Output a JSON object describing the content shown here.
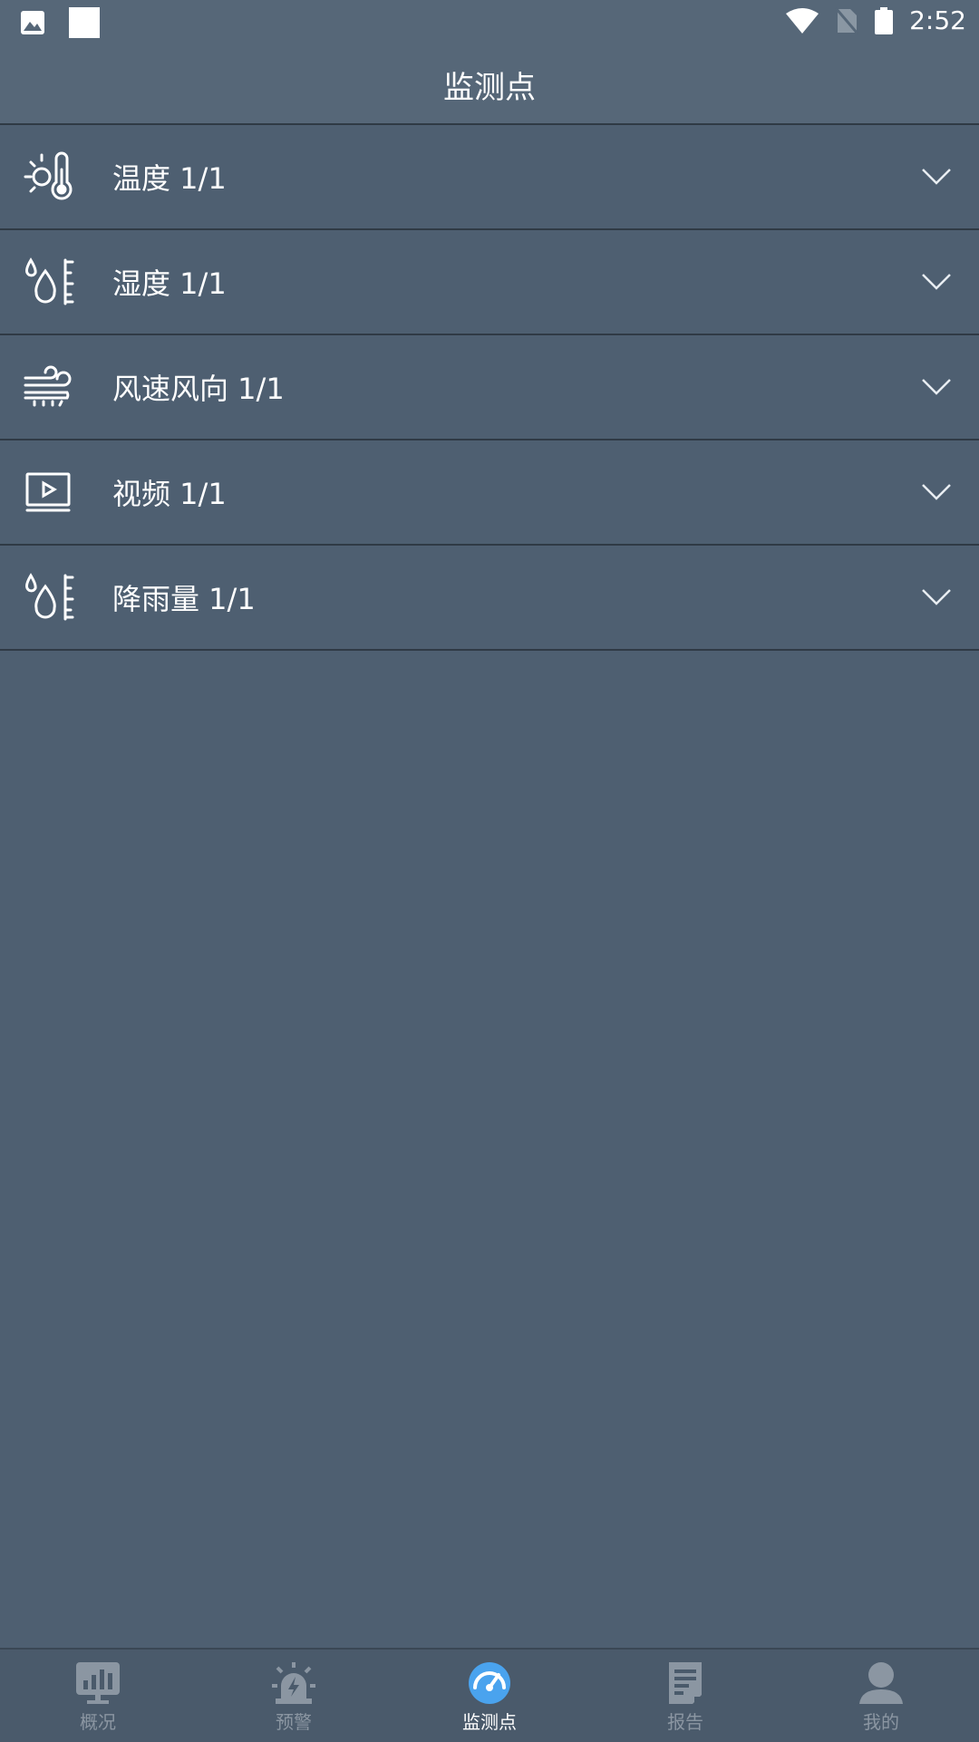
{
  "status": {
    "time": "2:52",
    "icons": [
      "image-icon",
      "square-notification-icon",
      "wifi-icon",
      "no-sim-icon",
      "battery-icon"
    ]
  },
  "appbar": {
    "title": "监测点"
  },
  "list": [
    {
      "icon": "thermometer-sun-icon",
      "label": "温度 1/1"
    },
    {
      "icon": "humidity-icon",
      "label": "湿度 1/1"
    },
    {
      "icon": "wind-icon",
      "label": "风速风向 1/1"
    },
    {
      "icon": "video-icon",
      "label": "视频 1/1"
    },
    {
      "icon": "rainfall-icon",
      "label": "降雨量 1/1"
    }
  ],
  "bottom_nav": [
    {
      "icon": "overview-chart-icon",
      "label": "概况",
      "active": false
    },
    {
      "icon": "alarm-siren-icon",
      "label": "预警",
      "active": false
    },
    {
      "icon": "gauge-icon",
      "label": "监测点",
      "active": true
    },
    {
      "icon": "report-icon",
      "label": "报告",
      "active": false
    },
    {
      "icon": "user-icon",
      "label": "我的",
      "active": false
    }
  ],
  "colors": {
    "background": "#4e5f71",
    "appbar": "#566778",
    "divider": "#2f3a45",
    "active_tab_icon": "#4aa3ee",
    "inactive_tab": "#8b96a2"
  }
}
